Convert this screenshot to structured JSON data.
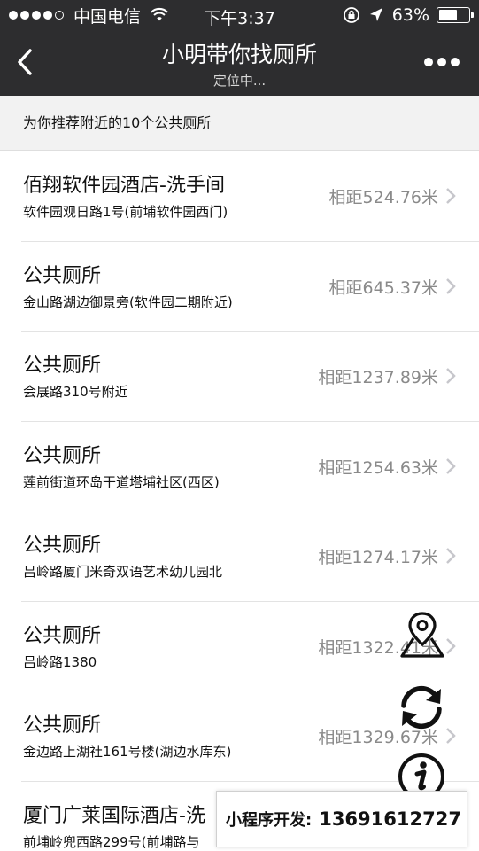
{
  "status_bar": {
    "carrier": "中国电信",
    "time": "下午3:37",
    "battery_text": "63%",
    "battery_level": 0.63
  },
  "nav": {
    "title": "小明带你找厕所",
    "subtitle": "定位中..."
  },
  "tip": "为你推荐附近的10个公共厕所",
  "items": [
    {
      "name": "佰翔软件园酒店-洗手间",
      "address": "软件园观日路1号(前埔软件园西门)",
      "distance": "相距524.76米"
    },
    {
      "name": "公共厕所",
      "address": "金山路湖边御景旁(软件园二期附近)",
      "distance": "相距645.37米"
    },
    {
      "name": "公共厕所",
      "address": "会展路310号附近",
      "distance": "相距1237.89米"
    },
    {
      "name": "公共厕所",
      "address": "莲前街道环岛干道塔埔社区(西区)",
      "distance": "相距1254.63米"
    },
    {
      "name": "公共厕所",
      "address": "吕岭路厦门米奇双语艺术幼儿园北",
      "distance": "相距1274.17米"
    },
    {
      "name": "公共厕所",
      "address": "吕岭路1380",
      "distance": "相距1322.41米"
    },
    {
      "name": "公共厕所",
      "address": "金边路上湖社161号楼(湖边水库东)",
      "distance": "相距1329.67米"
    },
    {
      "name": "厦门广莱国际酒店-洗",
      "address": "前埔岭兜西路299号(前埔路与",
      "distance": ""
    }
  ],
  "floating_buttons": [
    "map-pin-icon",
    "refresh-icon",
    "info-icon"
  ],
  "dev_banner": {
    "label": "小程序开发:",
    "phone": "13691612727"
  },
  "colors": {
    "nav_bg": "#2d2d2f",
    "tip_bg": "#f2f2f2",
    "distance_text": "#8a8a8a"
  }
}
